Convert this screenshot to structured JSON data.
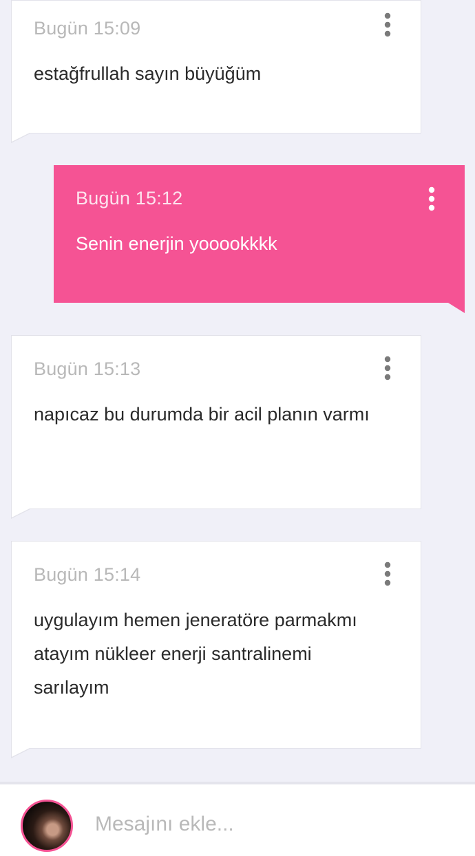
{
  "messages": [
    {
      "direction": "incoming",
      "time": "Bugün 15:09",
      "text": "estağfrullah sayın büyüğüm"
    },
    {
      "direction": "outgoing",
      "time": "Bugün 15:12",
      "text": "Senin enerjin yooookkkk"
    },
    {
      "direction": "incoming",
      "time": "Bugün 15:13",
      "text": "napıcaz bu durumda bir acil planın varmı"
    },
    {
      "direction": "incoming",
      "time": "Bugün 15:14",
      "text": "uygulayım hemen jeneratöre parmakmı atayım nükleer enerji santralinemi sarılayım"
    }
  ],
  "icons": {
    "message_menu": "more-vertical-icon",
    "composer_avatar": "user-avatar"
  },
  "composer": {
    "placeholder": "Mesajını ekle..."
  },
  "colors": {
    "accent": "#f55394",
    "background": "#f0f0f8",
    "incoming_bubble": "#ffffff",
    "timestamp": "#b8b8b8"
  }
}
